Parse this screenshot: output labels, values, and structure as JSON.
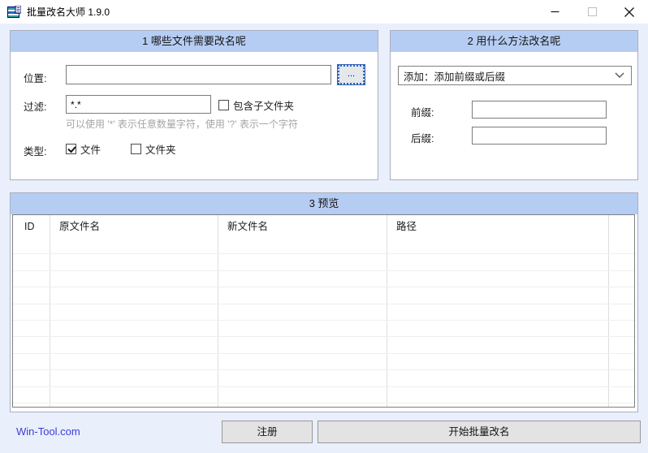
{
  "window": {
    "title": "批量改名大师 1.9.0"
  },
  "panel1": {
    "title": "1 哪些文件需要改名呢",
    "location_label": "位置:",
    "location_value": "",
    "browse_label": "...",
    "filter_label": "过滤:",
    "filter_value": "*.*",
    "include_subfolders_label": "包含子文件夹",
    "include_subfolders_checked": false,
    "hint": "可以使用 '*' 表示任意数量字符，使用 '?' 表示一个字符",
    "type_label": "类型:",
    "type_file_label": "文件",
    "type_file_checked": true,
    "type_folder_label": "文件夹",
    "type_folder_checked": false
  },
  "panel2": {
    "title": "2 用什么方法改名呢",
    "method_selected": "添加：添加前缀或后缀",
    "prefix_label": "前缀:",
    "prefix_value": "",
    "suffix_label": "后缀:",
    "suffix_value": ""
  },
  "panel3": {
    "title": "3 预览",
    "columns": [
      "ID",
      "原文件名",
      "新文件名",
      "路径"
    ],
    "rows": []
  },
  "footer": {
    "link": "Win-Tool.com",
    "register_label": "注册",
    "start_label": "开始批量改名"
  },
  "colors": {
    "window_background": "#e9effb",
    "panel_header_background": "#b6cdf3",
    "link_blue": "#3c3cd8",
    "focus_accent": "#2e63b8"
  }
}
